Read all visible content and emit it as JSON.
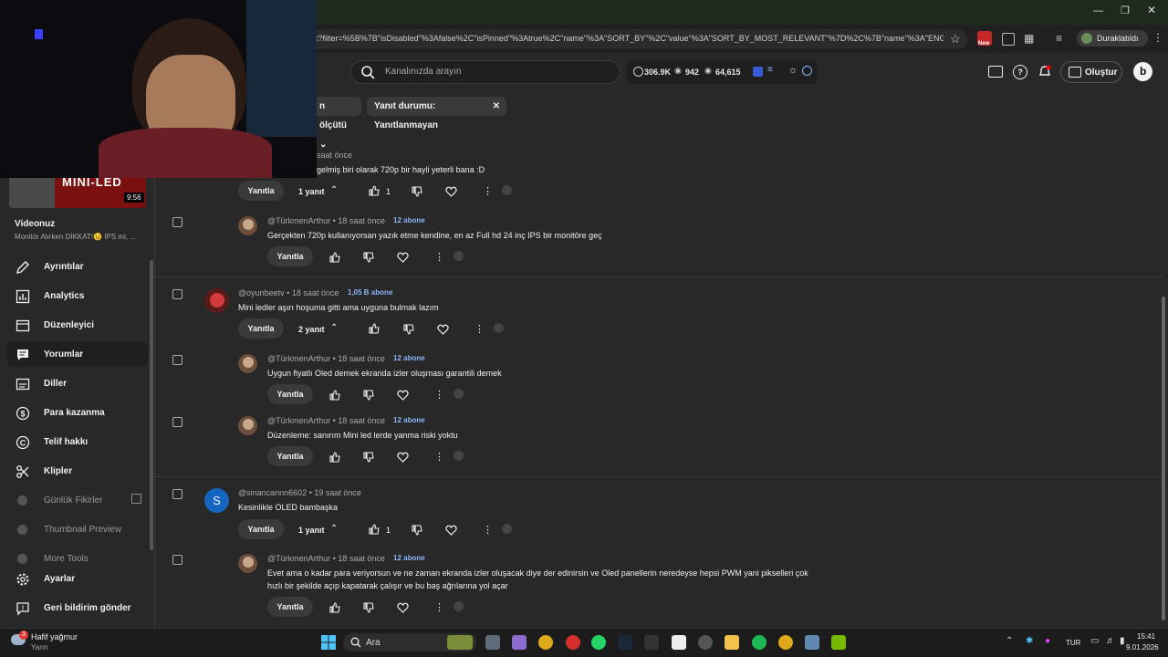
{
  "browser": {
    "url": "x?filter=%5B%7B\"isDisabled\"%3Afalse%2C\"isPinned\"%3Atrue%2C\"name\"%3A\"SORT_BY\"%2C\"value\"%3A\"SORT_BY_MOST_RELEVANT\"%7D%2C%7B\"name\"%3A\"ENG...",
    "paused_label": "Duraklatıldı",
    "new_badge": "New"
  },
  "header": {
    "search_placeholder": "Kanalınızda arayın",
    "stat_subs": "306.9K",
    "stat_views": "942",
    "stat_watch": "64,615",
    "create_label": "Oluştur"
  },
  "filters": {
    "sort_chip": "n ölçütü",
    "reply_chip": "Yanıt durumu: Yanıtlanmayan"
  },
  "video": {
    "thumb_text": "MINI-LED",
    "duration": "9:56",
    "label": "Videonuz",
    "title": "Monitör Alırken DİKKAT!😉 IPS mi, ..."
  },
  "sidebar": {
    "items": [
      {
        "label": "Ayrıntılar"
      },
      {
        "label": "Analytics"
      },
      {
        "label": "Düzenleyici"
      },
      {
        "label": "Yorumlar"
      },
      {
        "label": "Diller"
      },
      {
        "label": "Para kazanma"
      },
      {
        "label": "Telif hakkı"
      },
      {
        "label": "Klipler"
      },
      {
        "label": "Günlük Fikirler"
      },
      {
        "label": "Thumbnail Preview"
      },
      {
        "label": "More Tools"
      },
      {
        "label": "Ayarlar"
      },
      {
        "label": "Geri bildirim gönder"
      }
    ]
  },
  "comments": {
    "reply_label": "Yanıtla",
    "c0": {
      "time": "saat önce",
      "text": "gelmiş biri olarak 720p bir hayli yeterli bana :D",
      "replies": "1 yanıt",
      "likes": "1"
    },
    "r0a": {
      "handle": "@TürkmenArthur",
      "time": "18 saat önce",
      "subs": "12 abone",
      "text": "Gerçekten 720p kullanıyorsan yazık etme kendine, en az Full hd 24 inç IPS bir monitöre geç"
    },
    "c1": {
      "handle": "@oyunbeetv",
      "time": "18 saat önce",
      "subs": "1,05 B abone",
      "text": "Mini ledler aşırı hoşuma gitti ama uyguna bulmak lazım",
      "replies": "2 yanıt"
    },
    "r1a": {
      "handle": "@TürkmenArthur",
      "time": "18 saat önce",
      "subs": "12 abone",
      "text": "Uygun fiyatlı Oled demek ekranda izler oluşması garantili demek"
    },
    "r1b": {
      "handle": "@TürkmenArthur",
      "time": "18 saat önce",
      "subs": "12 abone",
      "text": "Düzenleme: sanırım Mini led lerde yanma riski yoktu"
    },
    "c2": {
      "handle": "@sinancannn6602",
      "avatar_letter": "S",
      "time": "19 saat önce",
      "text": "Kesinlikle OLED bambaşka",
      "replies": "1 yanıt",
      "likes": "1"
    },
    "r2a": {
      "handle": "@TürkmenArthur",
      "time": "18 saat önce",
      "subs": "12 abone",
      "text1": "Evet ama o kadar para veriyorsun ve ne zaman ekranda izler oluşacak diye der edinirsin ve Oled panellerin neredeyse hepsi PWM yani pikselleri çok",
      "text2": "hızlı bir şekilde açıp kapatarak çalışır ve bu baş ağrılarına yol açar"
    }
  },
  "taskbar": {
    "weather_badge": "3",
    "weather": "Hafif yağmur",
    "weather_sub": "Yarın",
    "search": "Ara",
    "lang": "TUR",
    "time": "15:41",
    "date": "9.01.2026",
    "colors": {
      "accent": "#3ea6ff",
      "chip": "#3a3a3a",
      "bg": "#282828"
    }
  }
}
